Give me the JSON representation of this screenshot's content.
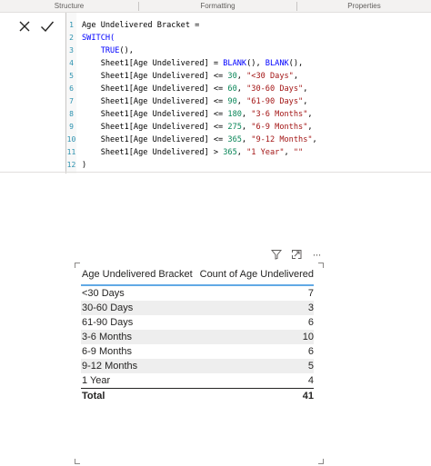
{
  "ribbon": {
    "tabs": [
      {
        "label": "Structure"
      },
      {
        "label": "Formatting"
      },
      {
        "label": "Properties"
      }
    ]
  },
  "formula_bar": {
    "cancel_icon": "close-icon",
    "commit_icon": "checkmark-icon",
    "lines": [
      {
        "n": "1",
        "parts": [
          {
            "t": "Age Undelivered Bracket =",
            "c": ""
          }
        ]
      },
      {
        "n": "2",
        "parts": [
          {
            "t": "SWITCH(",
            "c": "kw"
          }
        ]
      },
      {
        "n": "3",
        "parts": [
          {
            "t": "    ",
            "c": ""
          },
          {
            "t": "TRUE",
            "c": "kw"
          },
          {
            "t": "(),",
            "c": ""
          }
        ]
      },
      {
        "n": "4",
        "parts": [
          {
            "t": "    Sheet1[Age Undelivered] = ",
            "c": ""
          },
          {
            "t": "BLANK",
            "c": "kw"
          },
          {
            "t": "(), ",
            "c": ""
          },
          {
            "t": "BLANK",
            "c": "kw"
          },
          {
            "t": "(),",
            "c": ""
          }
        ]
      },
      {
        "n": "5",
        "parts": [
          {
            "t": "    Sheet1[Age Undelivered] <= ",
            "c": ""
          },
          {
            "t": "30",
            "c": "num"
          },
          {
            "t": ", ",
            "c": ""
          },
          {
            "t": "\"<30 Days\"",
            "c": "str"
          },
          {
            "t": ",",
            "c": ""
          }
        ]
      },
      {
        "n": "6",
        "parts": [
          {
            "t": "    Sheet1[Age Undelivered] <= ",
            "c": ""
          },
          {
            "t": "60",
            "c": "num"
          },
          {
            "t": ", ",
            "c": ""
          },
          {
            "t": "\"30-60 Days\"",
            "c": "str"
          },
          {
            "t": ",",
            "c": ""
          }
        ]
      },
      {
        "n": "7",
        "parts": [
          {
            "t": "    Sheet1[Age Undelivered] <= ",
            "c": ""
          },
          {
            "t": "90",
            "c": "num"
          },
          {
            "t": ", ",
            "c": ""
          },
          {
            "t": "\"61-90 Days\"",
            "c": "str"
          },
          {
            "t": ",",
            "c": ""
          }
        ]
      },
      {
        "n": "8",
        "parts": [
          {
            "t": "    Sheet1[Age Undelivered] <= ",
            "c": ""
          },
          {
            "t": "180",
            "c": "num"
          },
          {
            "t": ", ",
            "c": ""
          },
          {
            "t": "\"3-6 Months\"",
            "c": "str"
          },
          {
            "t": ",",
            "c": ""
          }
        ]
      },
      {
        "n": "9",
        "parts": [
          {
            "t": "    Sheet1[Age Undelivered] <= ",
            "c": ""
          },
          {
            "t": "275",
            "c": "num"
          },
          {
            "t": ", ",
            "c": ""
          },
          {
            "t": "\"6-9 Months\"",
            "c": "str"
          },
          {
            "t": ",",
            "c": ""
          }
        ]
      },
      {
        "n": "10",
        "parts": [
          {
            "t": "    Sheet1[Age Undelivered] <= ",
            "c": ""
          },
          {
            "t": "365",
            "c": "num"
          },
          {
            "t": ", ",
            "c": ""
          },
          {
            "t": "\"9-12 Months\"",
            "c": "str"
          },
          {
            "t": ",",
            "c": ""
          }
        ]
      },
      {
        "n": "11",
        "parts": [
          {
            "t": "    Sheet1[Age Undelivered] > ",
            "c": ""
          },
          {
            "t": "365",
            "c": "num"
          },
          {
            "t": ", ",
            "c": ""
          },
          {
            "t": "\"1 Year\"",
            "c": "str"
          },
          {
            "t": ", ",
            "c": ""
          },
          {
            "t": "\"\"",
            "c": "str"
          }
        ]
      },
      {
        "n": "12",
        "parts": [
          {
            "t": ")",
            "c": ""
          }
        ]
      }
    ]
  },
  "visual_header": {
    "icons": [
      "filter-icon",
      "focus-mode-icon",
      "more-options-icon"
    ],
    "more_glyph": "···"
  },
  "table": {
    "columns": [
      "Age Undelivered Bracket",
      "Count of Age Undelivered"
    ],
    "rows": [
      {
        "label": "<30 Days",
        "value": "7"
      },
      {
        "label": "30-60 Days",
        "value": "3"
      },
      {
        "label": "61-90 Days",
        "value": "6"
      },
      {
        "label": "3-6 Months",
        "value": "10"
      },
      {
        "label": "6-9 Months",
        "value": "6"
      },
      {
        "label": "9-12 Months",
        "value": "5"
      },
      {
        "label": "1 Year",
        "value": "4"
      }
    ],
    "total": {
      "label": "Total",
      "value": "41"
    }
  },
  "colors": {
    "keyword": "#0000ff",
    "string": "#a31515",
    "number": "#098658",
    "line_number": "#2b91af",
    "header_underline": "#61a9e5"
  }
}
